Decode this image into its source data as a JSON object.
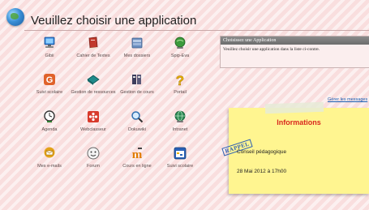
{
  "header": {
    "title": "Veuillez choisir une application"
  },
  "apps": [
    {
      "label": "Gibii",
      "icon": "computer-icon",
      "color": "#2f7fd8"
    },
    {
      "label": "Cahier de Textes",
      "icon": "book-icon",
      "color": "#c0392b"
    },
    {
      "label": "Mes dossiers",
      "icon": "folder-icon",
      "color": "#6c8ebf"
    },
    {
      "label": "Spip-Eva",
      "icon": "green-globe-icon",
      "color": "#3c9a3c"
    },
    {
      "label": "Suivi scolaire",
      "icon": "g-logo-icon",
      "color": "#e0622a"
    },
    {
      "label": "Gestion de ressources",
      "icon": "teal-book-icon",
      "color": "#1f8a8a"
    },
    {
      "label": "Gestion de cours",
      "icon": "binders-icon",
      "color": "#3d3d5c"
    },
    {
      "label": "Portail",
      "icon": "question-icon",
      "color": "#e8b000"
    },
    {
      "label": "Agenda",
      "icon": "clock-icon",
      "color": "#333333"
    },
    {
      "label": "Webclasseur",
      "icon": "flower-icon",
      "color": "#d83a2b"
    },
    {
      "label": "Dokuwiki",
      "icon": "magnifier-icon",
      "color": "#2f6fb0"
    },
    {
      "label": "Intranet",
      "icon": "network-globe-icon",
      "color": "#2e8b57"
    },
    {
      "label": "Mes e-mails",
      "icon": "mail-icon",
      "color": "#e3a21a"
    },
    {
      "label": "Forum",
      "icon": "face-icon",
      "color": "#888888"
    },
    {
      "label": "Cours en ligne",
      "icon": "moodle-icon",
      "color": "#e07b00"
    },
    {
      "label": "Suivi scolaire",
      "icon": "calendar-icon",
      "color": "#2a62b8"
    }
  ],
  "panel": {
    "title": "Choisissez une Application",
    "text": "Veuillez choisir une application dans la liste ci-contre."
  },
  "messages_link": "Gérer les messages",
  "note": {
    "title": "Informations",
    "stamp": "RAPPEL",
    "line1": "Conseil pédagogique",
    "line2": "28 Mai 2012 à 17h00"
  }
}
